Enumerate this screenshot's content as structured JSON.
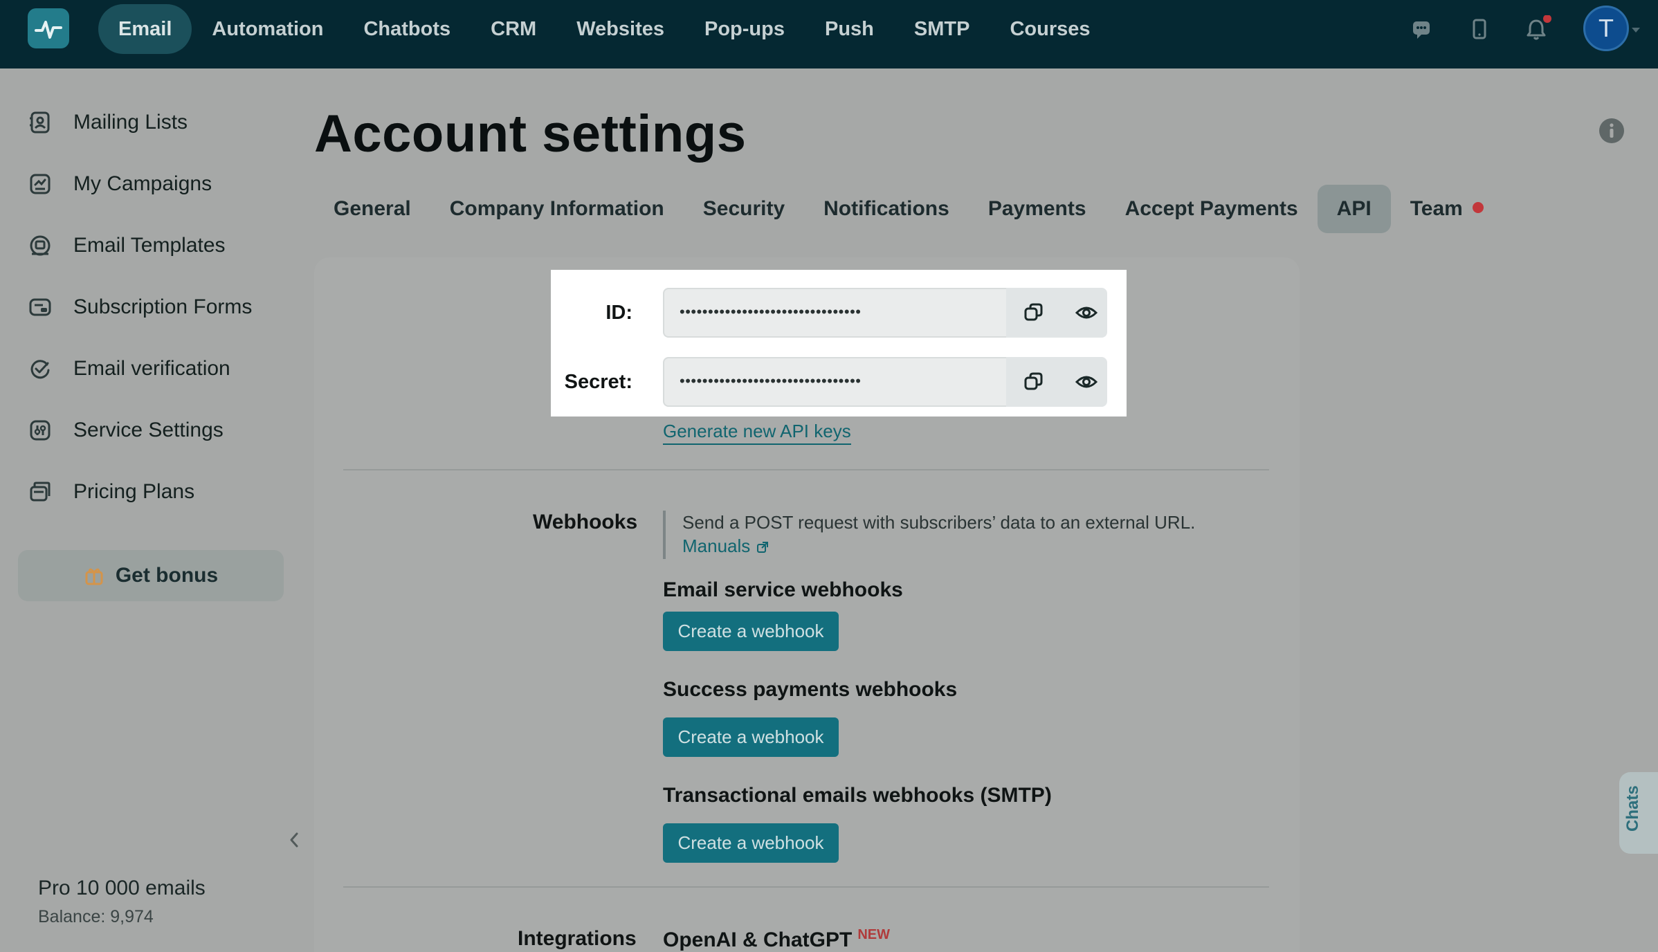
{
  "nav": {
    "items": [
      {
        "label": "Email",
        "active": true
      },
      {
        "label": "Automation"
      },
      {
        "label": "Chatbots"
      },
      {
        "label": "CRM"
      },
      {
        "label": "Websites"
      },
      {
        "label": "Pop-ups"
      },
      {
        "label": "Push"
      },
      {
        "label": "SMTP"
      },
      {
        "label": "Courses"
      }
    ],
    "avatar_letter": "T"
  },
  "sidebar": {
    "items": [
      {
        "label": "Mailing Lists",
        "icon": "address-book-icon"
      },
      {
        "label": "My Campaigns",
        "icon": "campaign-icon"
      },
      {
        "label": "Email Templates",
        "icon": "template-icon"
      },
      {
        "label": "Subscription Forms",
        "icon": "form-icon"
      },
      {
        "label": "Email verification",
        "icon": "verify-icon"
      },
      {
        "label": "Service Settings",
        "icon": "settings-icon"
      },
      {
        "label": "Pricing Plans",
        "icon": "pricing-icon"
      }
    ],
    "bonus_label": "Get bonus",
    "plan_name": "Pro 10 000 emails",
    "balance": "Balance: 9,974"
  },
  "page": {
    "title": "Account settings",
    "tabs": [
      {
        "label": "General"
      },
      {
        "label": "Company Information"
      },
      {
        "label": "Security"
      },
      {
        "label": "Notifications"
      },
      {
        "label": "Payments"
      },
      {
        "label": "Accept Payments"
      },
      {
        "label": "API",
        "active": true
      },
      {
        "label": "Team",
        "dot": true
      }
    ]
  },
  "api": {
    "id_label": "ID:",
    "id_value": "••••••••••••••••••••••••••••••••",
    "secret_label": "Secret:",
    "secret_value": "••••••••••••••••••••••••••••••••",
    "generate_link": "Generate new API keys"
  },
  "webhooks": {
    "section_label": "Webhooks",
    "description": "Send a POST request with subscribers’ data to an external URL.",
    "manuals_link": "Manuals",
    "groups": [
      {
        "heading": "Email service webhooks",
        "button": "Create a webhook"
      },
      {
        "heading": "Success payments webhooks",
        "button": "Create a webhook"
      },
      {
        "heading": "Transactional emails webhooks (SMTP)",
        "button": "Create a webhook"
      }
    ]
  },
  "integrations": {
    "section_label": "Integrations",
    "first_item": "OpenAI & ChatGPT",
    "new_badge": "NEW"
  },
  "chats_tab": "Chats",
  "colors": {
    "topbar": "#052832",
    "accent": "#136f7e",
    "link": "#11656f",
    "alert_dot": "#c2373b"
  }
}
